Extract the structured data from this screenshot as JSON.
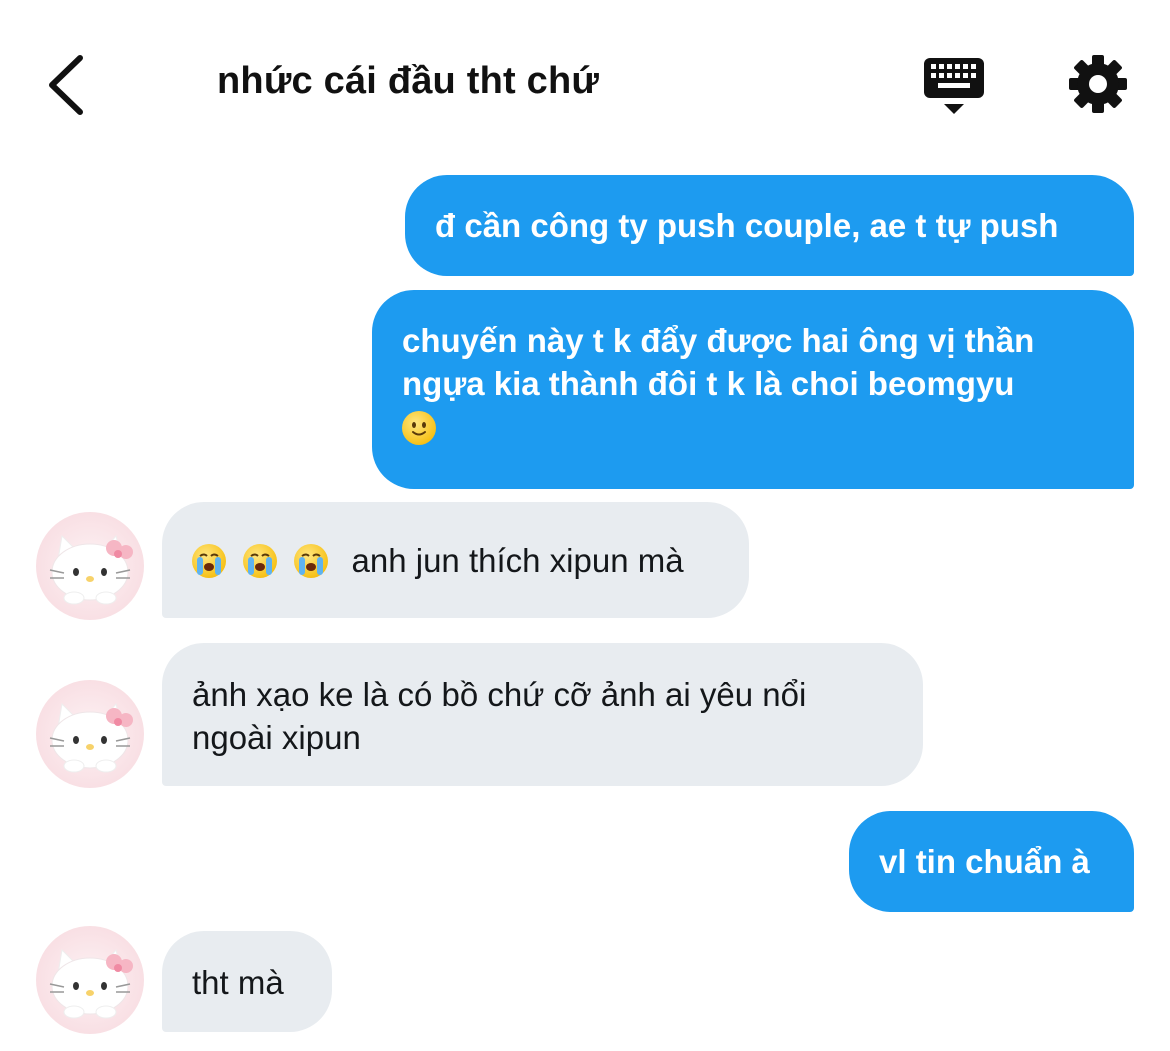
{
  "header": {
    "title": "nhức cái đầu tht chứ",
    "back_icon": "chevron-left-icon",
    "keyboard_icon": "keyboard-icon",
    "settings_icon": "gear-icon"
  },
  "colors": {
    "sent_bubble": "#1d9bf0",
    "received_bubble": "#e8ecf0",
    "sent_text": "#ffffff",
    "received_text": "#14171a"
  },
  "messages": [
    {
      "direction": "sent",
      "text": "đ cần công ty push couple, ae t tự push"
    },
    {
      "direction": "sent",
      "text": "chuyến này t k đẩy được hai ông vị thần ngựa kia thành đôi t k là choi beomgyu",
      "emoji": "slightly-smiling-face-emoji"
    },
    {
      "direction": "received",
      "emojis": [
        "loudly-crying-face-emoji",
        "loudly-crying-face-emoji",
        "loudly-crying-face-emoji"
      ],
      "text": "anh jun thích xipun mà"
    },
    {
      "direction": "received",
      "text": "ảnh xạo ke là có bồ chứ cỡ ảnh ai yêu nổi ngoài xipun"
    },
    {
      "direction": "sent",
      "text": "vl tin chuẩn à"
    },
    {
      "direction": "received",
      "text": "tht mà"
    }
  ]
}
